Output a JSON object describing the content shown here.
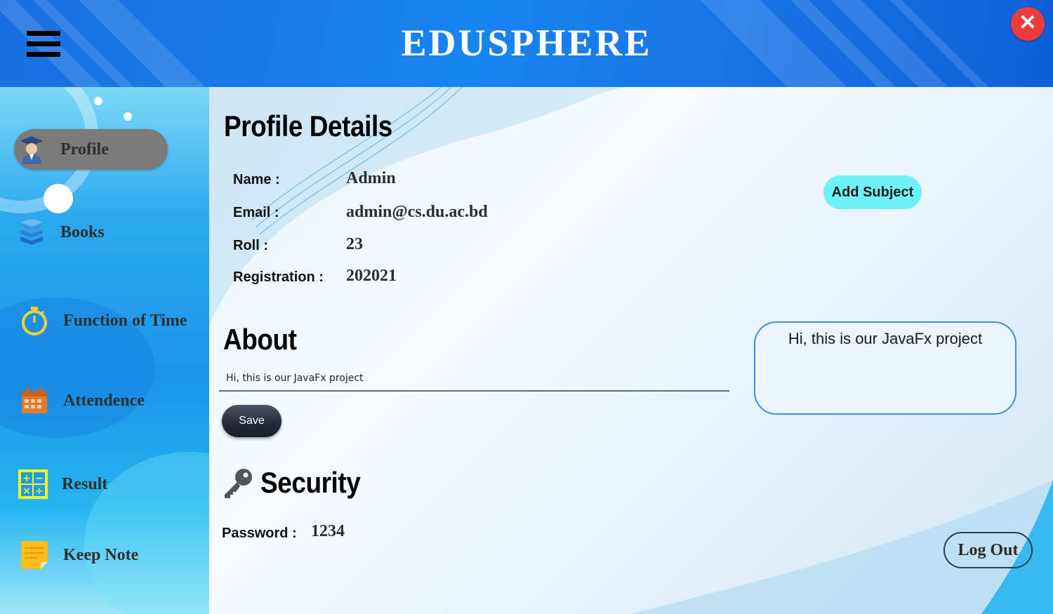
{
  "header": {
    "title": "EDUSPHERE",
    "menu_icon": "hamburger-menu-icon",
    "close_icon": "close-icon",
    "close_glyph": "✕"
  },
  "sidebar": {
    "items": [
      {
        "label": "Profile",
        "icon": "graduate-avatar-icon",
        "active": true
      },
      {
        "label": "Books",
        "icon": "books-stack-icon"
      },
      {
        "label": "Function of Time",
        "icon": "stopwatch-icon"
      },
      {
        "label": "Attendence",
        "icon": "calendar-icon"
      },
      {
        "label": "Result",
        "icon": "calculator-icon"
      },
      {
        "label": "Keep Note",
        "icon": "sticky-note-icon"
      }
    ]
  },
  "profile": {
    "heading": "Profile Details",
    "fields": [
      {
        "label": "Name  :",
        "value": "Admin"
      },
      {
        "label": "Email  :",
        "value": "admin@cs.du.ac.bd"
      },
      {
        "label": "Roll  :",
        "value": "23"
      },
      {
        "label": "Registration  :",
        "value": "202021"
      }
    ],
    "add_subject_label": "Add Subject"
  },
  "about": {
    "heading": "About",
    "input_value": "Hi, this is our JavaFx project",
    "save_label": "Save",
    "display_text": "Hi, this is our JavaFx project"
  },
  "security": {
    "heading": "Security",
    "icon": "key-icon",
    "password_label": "Password  :",
    "password_value": "1234"
  },
  "logout_label": "Log Out",
  "colors": {
    "header_blue": "#1784f0",
    "close_red": "#ef3b3b",
    "add_subject_cyan": "#6ff2fb",
    "save_dark": "#222a36",
    "about_box_border": "#3a8ee8"
  }
}
